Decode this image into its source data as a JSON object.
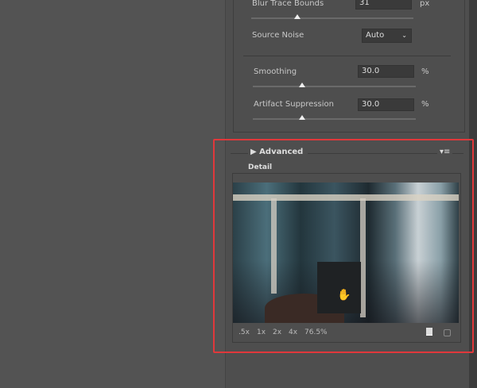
{
  "settings": {
    "blur_trace_bounds": {
      "label": "Blur Trace Bounds",
      "value": "31",
      "unit": "px",
      "slider_fraction": 0.28
    },
    "source_noise": {
      "label": "Source Noise",
      "value": "Auto"
    },
    "smoothing": {
      "label": "Smoothing",
      "value": "30.0",
      "unit": "%",
      "slider_fraction": 0.3
    },
    "artifact_suppression": {
      "label": "Artifact Suppression",
      "value": "30.0",
      "unit": "%",
      "slider_fraction": 0.3
    }
  },
  "advanced": {
    "title": "Advanced",
    "detail_label": "Detail",
    "zoom_options": [
      ".5x",
      "1x",
      "2x",
      "4x"
    ],
    "zoom_level": "76.5%"
  },
  "colors": {
    "highlight": "#e0383b",
    "panel": "#4e4e4e"
  }
}
